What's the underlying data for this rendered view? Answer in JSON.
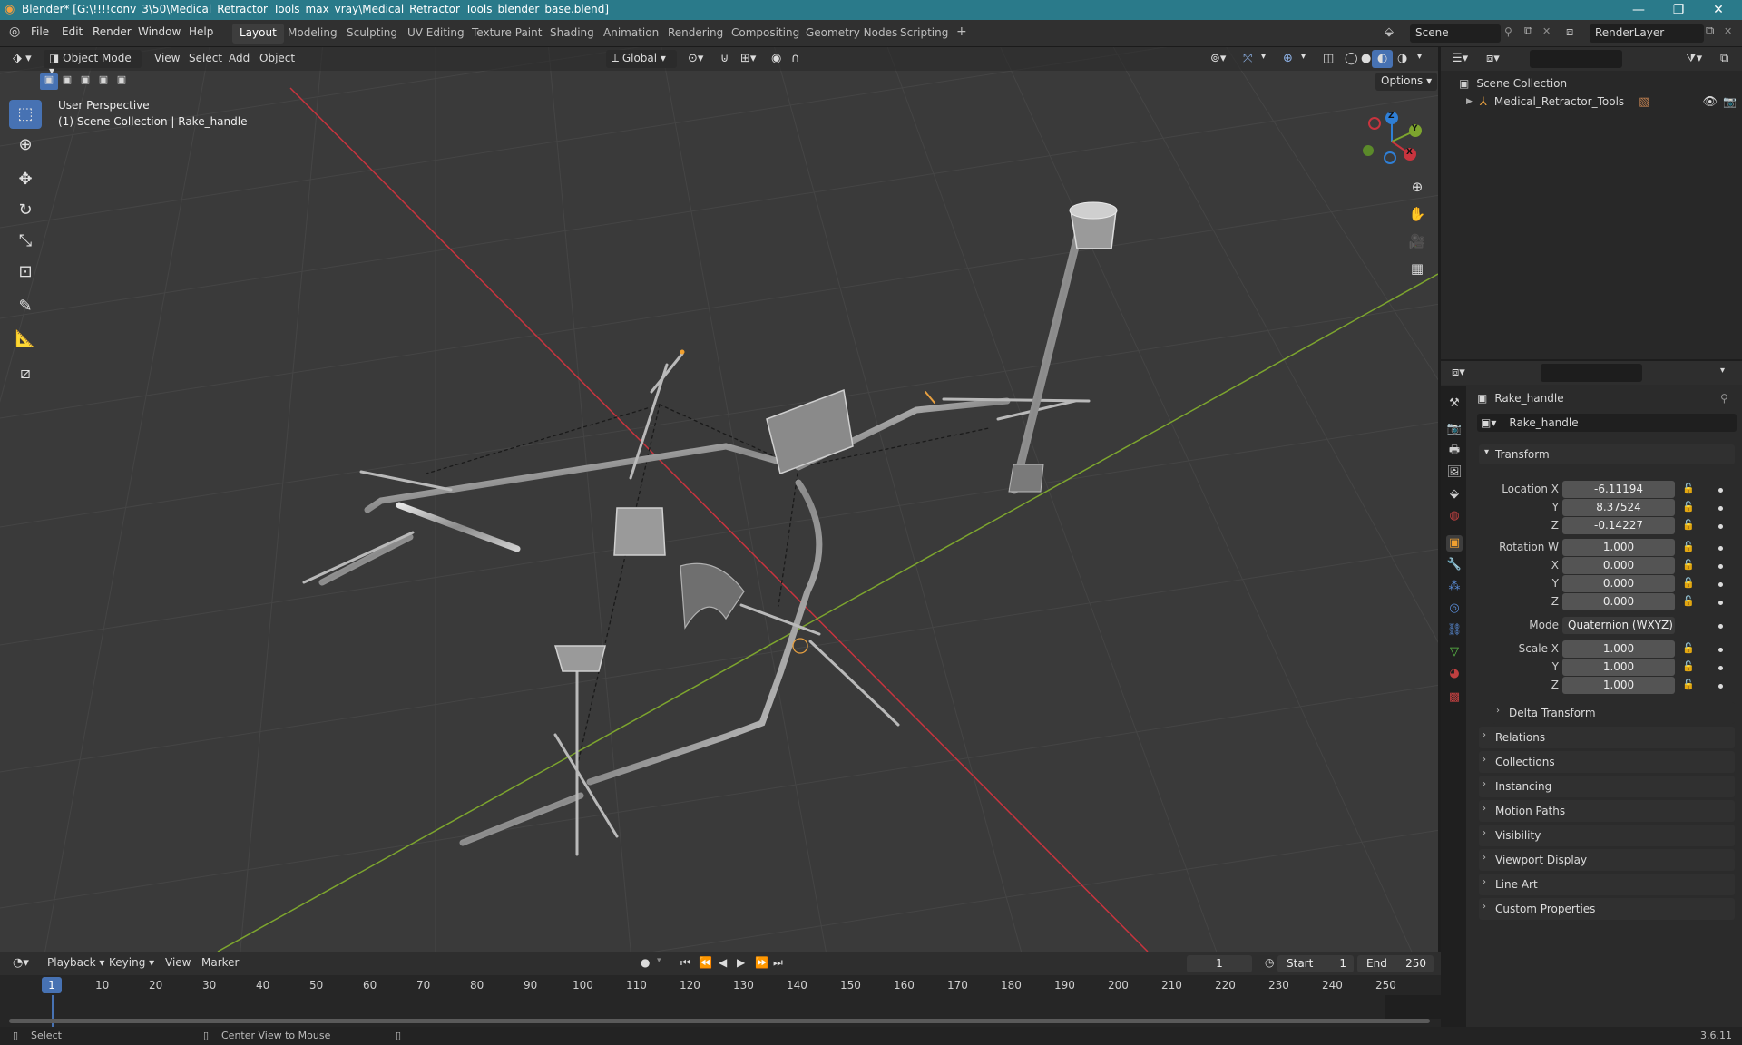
{
  "title_bar": {
    "title": "Blender* [G:\\!!!!conv_3\\50\\Medical_Retractor_Tools_max_vray\\Medical_Retractor_Tools_blender_base.blend]",
    "minimize": "—",
    "maximize": "❐",
    "close": "✕"
  },
  "menu": {
    "file": "File",
    "edit": "Edit",
    "render": "Render",
    "window": "Window",
    "help": "Help"
  },
  "workspaces": [
    "Layout",
    "Modeling",
    "Sculpting",
    "UV Editing",
    "Texture Paint",
    "Shading",
    "Animation",
    "Rendering",
    "Compositing",
    "Geometry Nodes",
    "Scripting"
  ],
  "workspace_add": "+",
  "scene": {
    "name": "Scene",
    "render_layer": "RenderLayer"
  },
  "viewport": {
    "mode": "Object Mode",
    "menus": {
      "view": "View",
      "select": "Select",
      "add": "Add",
      "object": "Object"
    },
    "orientation": "Global",
    "options": "Options",
    "overlay_title": "User Perspective",
    "overlay_sub": "(1) Scene Collection | Rake_handle",
    "gizmo": {
      "z": "Z",
      "y": "Y",
      "x": "X"
    },
    "colors": {
      "x_axis": "#c8343e",
      "y_axis": "#7da52e",
      "grid": "#454545",
      "background": "#3a3a3a"
    }
  },
  "outliner": {
    "search_placeholder": "",
    "root": "Scene Collection",
    "items": [
      {
        "name": "Medical_Retractor_Tools"
      }
    ]
  },
  "properties": {
    "object_name": "Rake_handle",
    "data_name": "Rake_handle",
    "transform_title": "Transform",
    "location": {
      "label_x": "Location X",
      "label_y": "Y",
      "label_z": "Z",
      "x": "-6.11194",
      "y": "8.37524",
      "z": "-0.14227"
    },
    "rotation": {
      "label_w": "Rotation W",
      "label_x": "X",
      "label_y": "Y",
      "label_z": "Z",
      "w": "1.000",
      "x": "0.000",
      "y": "0.000",
      "z": "0.000"
    },
    "mode": {
      "label": "Mode",
      "value": "Quaternion (WXYZ)"
    },
    "scale": {
      "label_x": "Scale X",
      "label_y": "Y",
      "label_z": "Z",
      "x": "1.000",
      "y": "1.000",
      "z": "1.000"
    },
    "panels": [
      "Delta Transform",
      "Relations",
      "Collections",
      "Instancing",
      "Motion Paths",
      "Visibility",
      "Viewport Display",
      "Line Art",
      "Custom Properties"
    ]
  },
  "timeline": {
    "menus": {
      "playback": "Playback",
      "keying": "Keying",
      "view": "View",
      "marker": "Marker"
    },
    "current_frame": "1",
    "start_label": "Start",
    "start": "1",
    "end_label": "End",
    "end": "250",
    "ticks": [
      "1",
      "10",
      "20",
      "30",
      "40",
      "50",
      "60",
      "70",
      "80",
      "90",
      "100",
      "110",
      "120",
      "130",
      "140",
      "150",
      "160",
      "170",
      "180",
      "190",
      "200",
      "210",
      "220",
      "230",
      "240",
      "250"
    ]
  },
  "status": {
    "select": "Select",
    "center": "Center View to Mouse",
    "version": "3.6.11"
  }
}
